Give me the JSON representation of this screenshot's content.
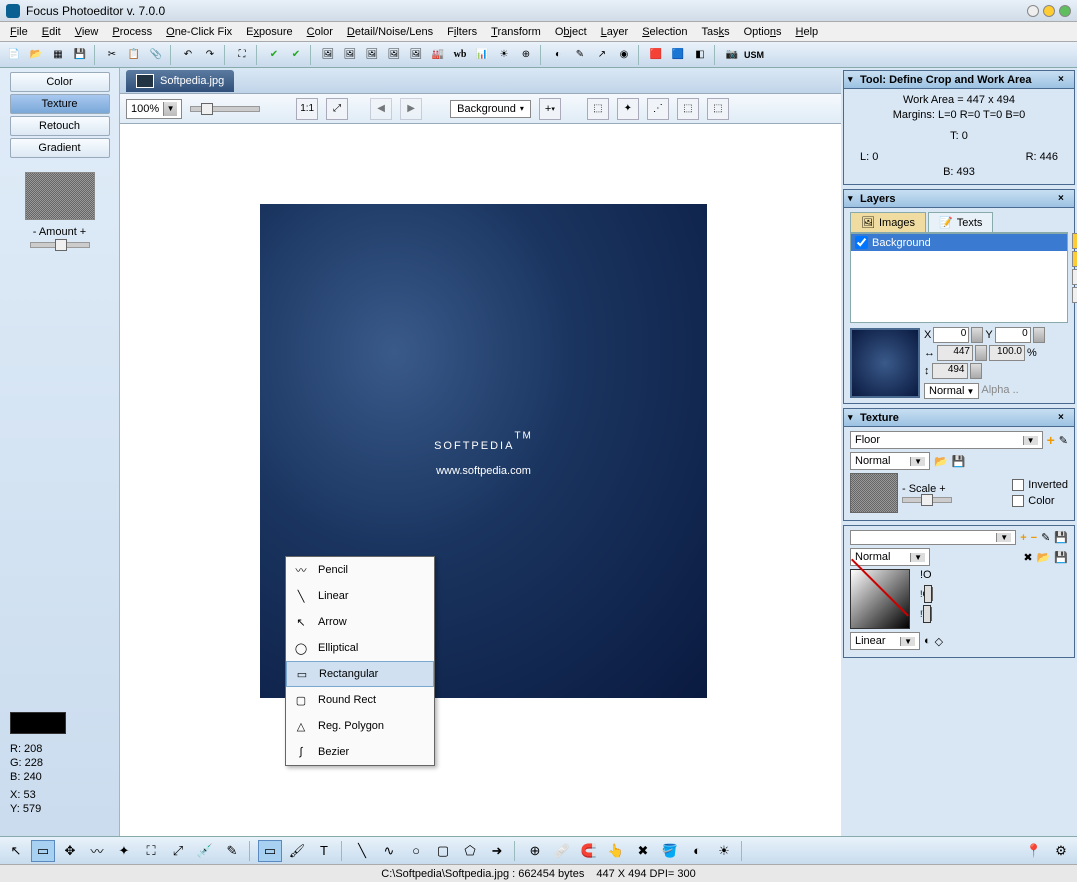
{
  "window": {
    "title": "Focus Photoeditor v. 7.0.0"
  },
  "menu": [
    "File",
    "Edit",
    "View",
    "Process",
    "One-Click Fix",
    "Exposure",
    "Color",
    "Detail/Noise/Lens",
    "Filters",
    "Transform",
    "Object",
    "Layer",
    "Selection",
    "Tasks",
    "Options",
    "Help"
  ],
  "left_tabs": [
    "Color",
    "Texture",
    "Retouch",
    "Gradient"
  ],
  "left_active": 1,
  "amount_label": "- Amount +",
  "doc_tab": "Softpedia.jpg",
  "zoom": "100%",
  "bg_dropdown": "Background",
  "plus_btn": "+",
  "canvas": {
    "brand": "SOFTPEDIA",
    "tm": "TM",
    "url": "www.softpedia.com"
  },
  "popup": [
    "Pencil",
    "Linear",
    "Arrow",
    "Elliptical",
    "Rectangular",
    "Round Rect",
    "Reg. Polygon",
    "Bezier"
  ],
  "popup_selected": 4,
  "readout": {
    "R": "R: 208",
    "G": "G: 228",
    "B": "B: 240",
    "X": "X: 53",
    "Y": "Y: 579"
  },
  "crop_panel": {
    "title": "Tool: Define Crop and Work Area",
    "work_area": "Work Area = 447 x 494",
    "margins": "Margins: L=0 R=0 T=0 B=0",
    "T": "T: 0",
    "L": "L: 0",
    "R": "R: 446",
    "B": "B: 493"
  },
  "layers_panel": {
    "title": "Layers",
    "tabs": [
      "Images",
      "Texts"
    ],
    "active_tab": 0,
    "rows": [
      "Background"
    ],
    "X_lbl": "X",
    "Y_lbl": "Y",
    "X": "0",
    "Y": "0",
    "W": "447",
    "H": "494",
    "pct": "100.0",
    "pct_suffix": "%",
    "blend": "Normal",
    "alpha": "Alpha .."
  },
  "texture_panel": {
    "title": "Texture",
    "name": "Floor",
    "blend": "Normal",
    "scale": "- Scale +",
    "inverted": "Inverted",
    "color": "Color"
  },
  "bottom_panel": {
    "blend": "Normal",
    "grad_type": "Linear",
    "labels": {
      "c1": "!O",
      "c2": "!C",
      "c3": "!T"
    }
  },
  "status": {
    "path": "C:\\Softpedia\\Softpedia.jpg : 662454 bytes",
    "dims": "447 X 494 DPI=  300"
  }
}
